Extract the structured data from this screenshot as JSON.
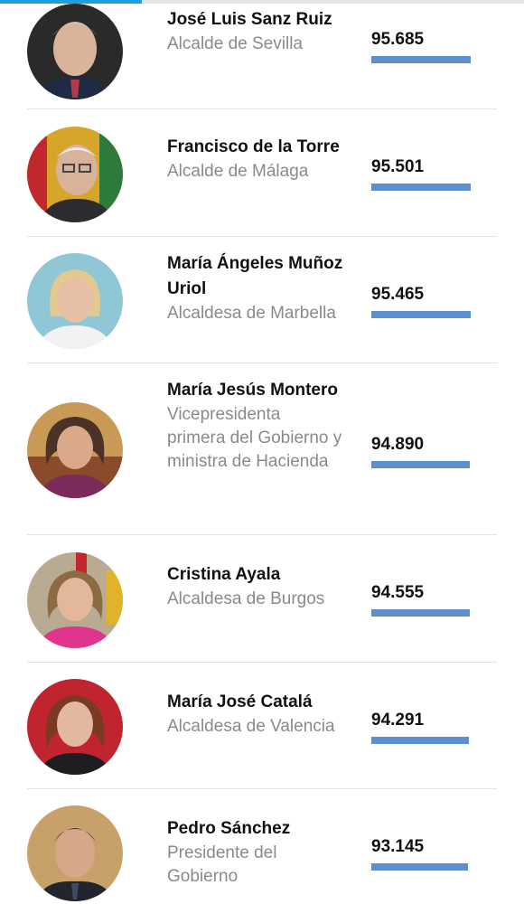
{
  "scroll_progress": 0.27,
  "bar_color": "#5b8fd0",
  "max_value": 95.685,
  "people": [
    {
      "name": "José Luis Sanz Ruiz",
      "role": "Alcalde de Sevilla",
      "score": "95.685",
      "value": 95.685,
      "photo": "man-grey-hair-avatar"
    },
    {
      "name": "Francisco de la Torre",
      "role": "Alcalde de Málaga",
      "score": "95.501",
      "value": 95.501,
      "photo": "elderly-man-glasses-avatar"
    },
    {
      "name": "María Ángeles Muñoz Uriol",
      "role": "Alcaldesa de Marbella",
      "score": "95.465",
      "value": 95.465,
      "photo": "blonde-woman-avatar"
    },
    {
      "name": "María Jesús Montero",
      "role": "Vicepresidenta primera del Gobierno y ministra de Hacienda",
      "score": "94.890",
      "value": 94.89,
      "photo": "woman-curly-hair-avatar"
    },
    {
      "name": "Cristina Ayala",
      "role": "Alcaldesa de Burgos",
      "score": "94.555",
      "value": 94.555,
      "photo": "woman-pink-top-avatar"
    },
    {
      "name": "María José Catalá",
      "role": "Alcaldesa de Valencia",
      "score": "94.291",
      "value": 94.291,
      "photo": "woman-red-background-avatar"
    },
    {
      "name": "Pedro Sánchez",
      "role": "Presidente del Gobierno",
      "score": "93.145",
      "value": 93.145,
      "photo": "man-dark-hair-avatar"
    }
  ]
}
